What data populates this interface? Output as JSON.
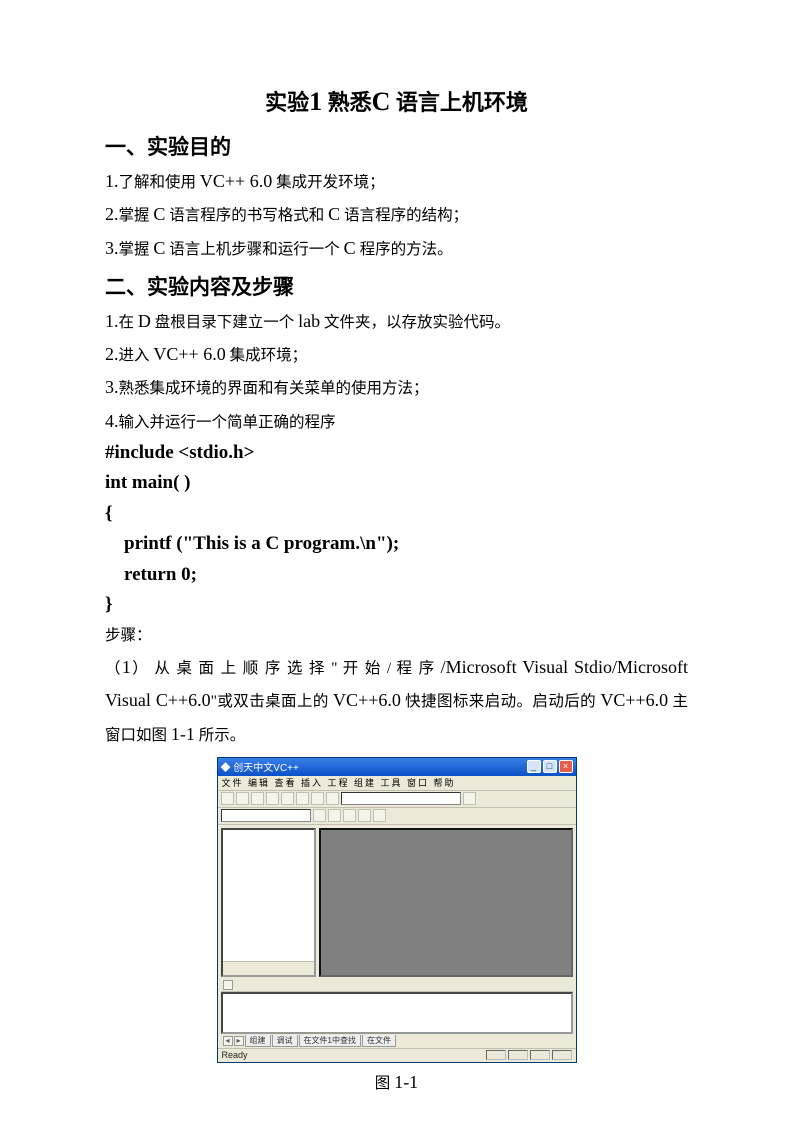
{
  "title_pre": "实验",
  "title_num": "1",
  "title_mid": " 熟悉",
  "title_latin": "C",
  "title_suf": " 语言上机环境",
  "section1": "一、实验目的",
  "s1_items": [
    {
      "n": "1.",
      "pre": "了解和使用 ",
      "latin": "VC++ 6.0",
      "suf": " 集成开发环境；"
    },
    {
      "n": "2.",
      "pre": "掌握 ",
      "latin": "C",
      "mid": " 语言程序的书写格式和 ",
      "latin2": "C",
      "suf": " 语言程序的结构；"
    },
    {
      "n": "3.",
      "pre": "掌握 ",
      "latin": "C",
      "mid": " 语言上机步骤和运行一个 ",
      "latin2": "C",
      "suf": " 程序的方法。"
    }
  ],
  "section2": "二、实验内容及步骤",
  "s2_items": [
    {
      "n": "1.",
      "pre": "在 ",
      "latin": "D",
      "mid": " 盘根目录下建立一个 ",
      "latin2": "lab",
      "suf": " 文件夹，以存放实验代码。"
    },
    {
      "n": "2.",
      "pre": "进入 ",
      "latin": "VC++ 6.0",
      "suf": " 集成环境；"
    },
    {
      "n": "3.",
      "pre": "熟悉集成环境的界面和有关菜单的使用方法；",
      "latin": "",
      "suf": ""
    },
    {
      "n": "4.",
      "pre": "输入并运行一个简单正确的程序",
      "latin": "",
      "suf": ""
    }
  ],
  "code_lines": [
    "#include <stdio.h>",
    "int main( )",
    "{",
    "    printf (\"This is a C program.\\n\");",
    "    return 0;",
    "}"
  ],
  "steps_label": "步骤：",
  "para1_a": "（",
  "para1_n": "1",
  "para1_b": "） 从 桌 面 上 顺 序 选 择 \" 开 始 / 程 序 ",
  "para1_latin1": "/Microsoft Visual Stdio/Microsoft Visual C++6.0",
  "para1_c": "\"或双击桌面上的 ",
  "para1_latin2": "VC++6.0",
  "para1_d": " 快捷图标来启动。启动后的 ",
  "para1_latin3": "VC++6.0",
  "para1_e": " 主窗口如图 ",
  "para1_fign": "1-1",
  "para1_f": " 所示。",
  "vc": {
    "title": "创天中文VC++",
    "menu": "文件 编辑 查看 插入 工程 组建 工具 窗口 帮助",
    "tabs": [
      "组建",
      "调试",
      "在文件1中查找",
      "在文件"
    ],
    "status": "Ready"
  },
  "caption_pre": "图 ",
  "caption_num": "1-1"
}
